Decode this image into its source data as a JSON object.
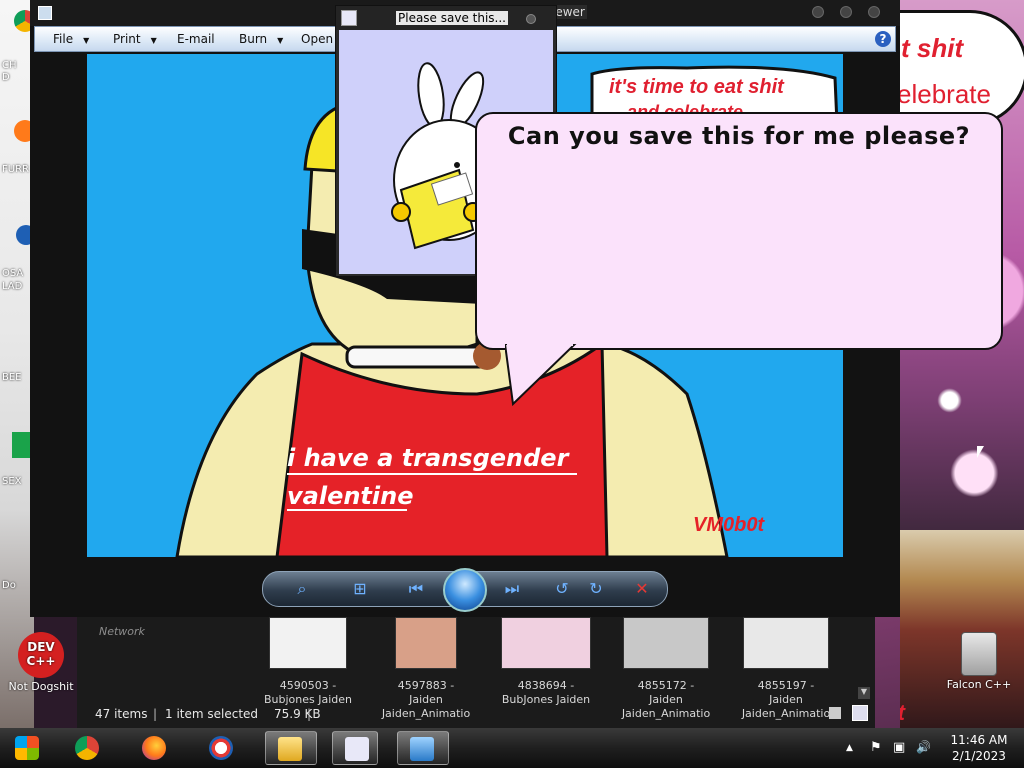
{
  "desktop": {
    "left_fragments": [
      "CH",
      "D",
      "FURR",
      "OSA",
      "LAD",
      "BEE",
      "SEX",
      "Do"
    ],
    "dev_icon": {
      "logo_line1": "DEV",
      "logo_line2": "C++",
      "label": "Not Dogshit"
    },
    "falcon_icon": {
      "label": "Falcon C++"
    },
    "bg_bubble": {
      "line1": "t shit",
      "line2": "elebrate"
    },
    "bg_text": "b0t"
  },
  "viewer": {
    "title": "iewer",
    "menu": [
      {
        "label": "File",
        "has_arrow": true
      },
      {
        "label": "Print",
        "has_arrow": true
      },
      {
        "label": "E-mail",
        "has_arrow": false
      },
      {
        "label": "Burn",
        "has_arrow": true
      },
      {
        "label": "Open",
        "has_arrow": false
      }
    ],
    "help_icon": "?",
    "image": {
      "top_bubble_line1": "it's time to eat shit",
      "top_bubble_line2": "and celebrate",
      "shirt_line1": "i have a transgender",
      "shirt_line2": "valentine",
      "signature": "VM0b0t"
    },
    "toolbar_icons": [
      "zoom-icon",
      "fit-icon",
      "previous-icon",
      "slideshow-icon",
      "next-icon",
      "rotate-left-icon",
      "rotate-right-icon",
      "delete-icon"
    ]
  },
  "save_window": {
    "title": "Please save this...",
    "message": "Can you save this for me please?"
  },
  "explorer": {
    "network_label": "Network",
    "thumbnails": [
      {
        "line1": "4590503 -",
        "line2": "Bubjones Jaiden"
      },
      {
        "line1": "4597883 - Jaiden",
        "line2": "Jaiden_Animatio"
      },
      {
        "line1": "4838694 -",
        "line2": "BubJones Jaiden"
      },
      {
        "line1": "4855172 - Jaiden",
        "line2": "Jaiden_Animatio"
      },
      {
        "line1": "4855197 - Jaiden",
        "line2": "Jaiden_Animatio"
      }
    ],
    "status": {
      "items": "47 items",
      "selected": "1 item selected",
      "size": "75.9 KB"
    }
  },
  "taskbar": {
    "apps": [
      "windows-start-icon",
      "chrome-icon",
      "firefox-icon",
      "obama-icon",
      "file-explorer-icon",
      "bunny-app-icon",
      "photo-viewer-icon"
    ],
    "tray": {
      "show_hidden": "▲",
      "flag": "⚑",
      "network": "▣",
      "volume": "🔊"
    },
    "time": "11:46 AM",
    "date": "2/1/2023"
  }
}
